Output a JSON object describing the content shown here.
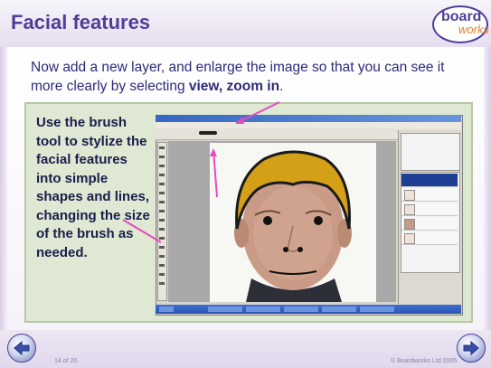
{
  "slide": {
    "title": "Facial features",
    "logo": {
      "top": "board",
      "bottom": "works"
    },
    "intro_parts": [
      "Now add a new layer, and enlarge the image so that you can see it more clearly by selecting ",
      "view, zoom in",
      "."
    ],
    "instruction": {
      "p1": "Use the ",
      "b1": "brush tool",
      "p2": " to ",
      "b2": "stylize",
      "p3": " the facial features into simple shapes and lines, changing the size of the brush as needed."
    },
    "footer": {
      "page_number": "14 of 20",
      "copyright": "© Boardworks Ltd 2005"
    }
  },
  "colors": {
    "title": "#4e3f98",
    "intro_text": "#2c2a7a",
    "panel_bg": "#dfe8d2",
    "arrow": "#e84ac0",
    "hair": "#d4a017"
  },
  "icons": {
    "back": "left-arrow-icon",
    "forward": "right-arrow-icon",
    "logo": "boardworks-logo"
  }
}
